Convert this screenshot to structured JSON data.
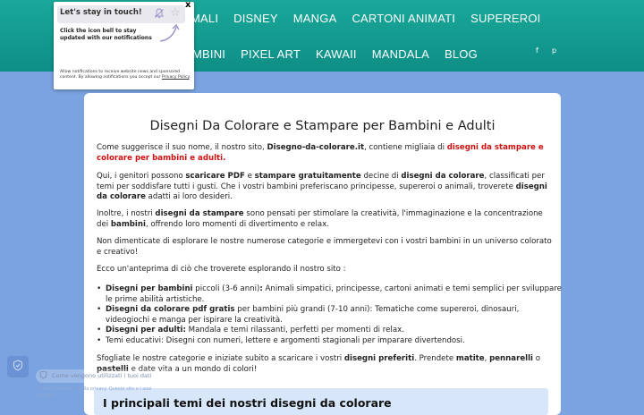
{
  "nav": {
    "row1": [
      "MALI",
      "DISNEY",
      "MANGA",
      "CARTONI ANIMATI",
      "SUPEREROI"
    ],
    "row2": [
      "MBINI",
      "PIXEL ART",
      "KAWAII",
      "MANDALA",
      "BLOG"
    ],
    "social_facebook": "f",
    "social_pinterest": "p"
  },
  "popup": {
    "title": "Let's stay in touch!",
    "close": "x",
    "text": "Click the icon bell to stay updated with our notifications",
    "footer_text": "Allow notifications to receive website news and sponsored content. By allowing notifications you accept our",
    "footer_link": "Privacy Policy",
    "footer_end": "."
  },
  "content": {
    "title": "Disegni Da Colorare e Stampare per Bambini e Adulti",
    "p1_a": "Come suggerisce il suo nome, il nostro sito, ",
    "p1_b": "Disegno-da-colorare.it",
    "p1_c": ", contiene migliaia di ",
    "p1_d": "disegni da stampare e colorare per bambini e adulti.",
    "p2_a": "Qui, i genitori possono ",
    "p2_b": "scaricare PDF",
    "p2_c": " e ",
    "p2_d": "stampare gratuitamente",
    "p2_e": " decine di ",
    "p2_f": "disegni da colorare",
    "p2_g": ", classificati per temi per soddisfare tutti i gusti. Che i vostri bambini preferiscano principesse, supereroi o animali, troverete ",
    "p2_h": "disegni da colorare",
    "p2_i": " adatti ai loro desideri.",
    "p3_a": "Inoltre, i nostri ",
    "p3_b": "disegni da stampare",
    "p3_c": " sono pensati per stimolare la creatività, l'immaginazione e la concentrazione dei ",
    "p3_d": "bambini",
    "p3_e": ", offrendo loro momenti di divertimento e relax.",
    "p4": "Non dimenticate di esplorare le nostre numerose categorie e immergetevi con i vostri bambini in un universo colorato e creativo!",
    "p5": "Ecco un'anteprima di ciò che troverete esplorando il nostro sito :",
    "li1_b": "Disegni per bambini",
    "li1_t": " piccoli (3-6 anni)",
    "li1_c": ":",
    "li1_r": " Animali simpatici, principesse, cartoni animati e temi semplici per sviluppare le prime abilità artistiche.",
    "li2_b": "Disegni da colorare pdf gratis",
    "li2_r": " per bambini più grandi (7-10 anni): Tematiche come supereroi, dinosauri, videogiochi e manga per ispirare la creatività.",
    "li3_b": "Disegni per adulti:",
    "li3_r": " Mandala e temi rilassanti, perfetti per momenti di relax.",
    "li4": "Temi educativi: Disegni con numeri, lettere e argomenti stagionali per imparare divertendosi.",
    "p6_a": "Sfogliate le nostre categorie e iniziate subito a scaricare i vostri ",
    "p6_b": "disegni preferiti",
    "p6_c": ". Prendete ",
    "p6_d": "matite",
    "p6_e": ", ",
    "p6_f": "pennarelli",
    "p6_g": " o ",
    "p6_h": "pastelli",
    "p6_i": " e date vita a un mondo di colori!",
    "section_title": "I principali temi dei nostri disegni da colorare"
  },
  "cookie": {
    "pill_text": "Come vengono utilizzati i tuoi dati",
    "under_text": "Le tue preferenze sulla privacy. Questo sito e i suoi partner"
  },
  "colors": {
    "header": "#0e8e86",
    "background": "#7ba3e0",
    "accent_red": "#d10f0f",
    "section_bar": "#d8e6fa"
  }
}
